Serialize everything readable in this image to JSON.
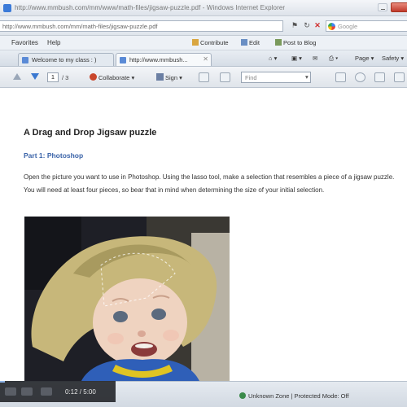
{
  "window": {
    "title": "http://www.mmbush.com/mm/www/math-files/jigsaw-puzzle.pdf - Windows Internet Explorer"
  },
  "address_bar": {
    "url": "http://www.mmbush.com/mm/math-files/jigsaw-puzzle.pdf",
    "search_placeholder": "Google"
  },
  "menu": {
    "items": [
      "Favorites",
      "Help"
    ],
    "toolbar": [
      "Contribute",
      "Edit",
      "Post to Blog"
    ]
  },
  "tabs": [
    {
      "label": "Welcome to my class : )"
    },
    {
      "label": "http://www.mmbush..."
    }
  ],
  "tab_tools": {
    "page": "Page",
    "safety": "Safety"
  },
  "pdf_toolbar": {
    "page_number": "1",
    "page_total": "/ 3",
    "collaborate": "Collaborate",
    "sign": "Sign",
    "find_placeholder": "Find"
  },
  "document": {
    "title": "A Drag and Drop Jigsaw puzzle",
    "part_heading": "Part 1: Photoshop",
    "paragraph": "Open the picture you want to use in Photoshop.  Using the lasso tool, make a selection that resembles a piece of a jigsaw puzzle.  You will need at least four pieces, so bear that in mind when determining the size of your initial selection."
  },
  "status_bar": {
    "zone": "Unknown Zone | Protected Mode: Off"
  },
  "video_player": {
    "time": "0:12 / 5:00",
    "progress": 0.04
  },
  "colors": {
    "heading_blue": "#3a63a8",
    "chrome_bg": "#dfe5ec"
  }
}
